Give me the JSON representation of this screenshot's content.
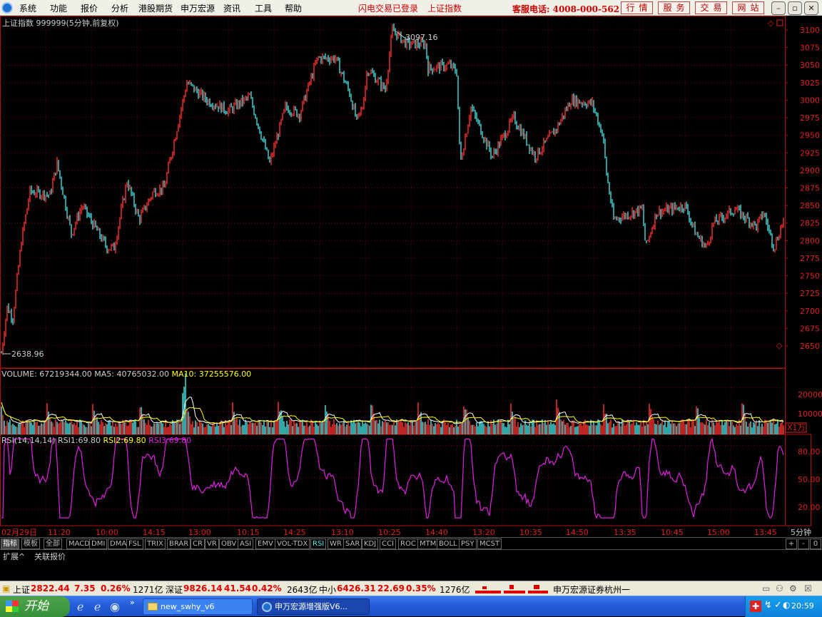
{
  "menu": {
    "items": [
      "系统",
      "功能",
      "报价",
      "分析",
      "港股期货",
      "申万宏源",
      "资讯",
      "工具",
      "帮助"
    ],
    "login_status": "闪电交易已登录",
    "current_index": "上证指数",
    "service_phone": "客服电话: 4008-000-562",
    "buttons": [
      "行情",
      "服务",
      "交易",
      "网站"
    ]
  },
  "chart": {
    "title": "上证指数 999999(5分钟,前复权)",
    "high_label": "3097.16",
    "low_label": "2638.96",
    "price_axis": [
      "3100",
      "3075",
      "3050",
      "3025",
      "3000",
      "2975",
      "2950",
      "2925",
      "2900",
      "2875",
      "2850",
      "2825",
      "2800",
      "2775",
      "2750",
      "2725",
      "2700",
      "2675",
      "2650"
    ],
    "volume": {
      "label_name": "VOLUME:",
      "value": "67219344.00",
      "ma5_name": "MA5:",
      "ma5_value": "40765032.00",
      "ma10_name": "MA10:",
      "ma10_value": "37255576.00",
      "axis": [
        "20000",
        "10000"
      ],
      "unit": "X1万"
    },
    "rsi": {
      "label_name": "RSI(14,14,14)",
      "rsi1_name": "RSI1:",
      "rsi1": "69.80",
      "rsi2_name": "RSI2:",
      "rsi2": "69.80",
      "rsi3_name": "RSI3:",
      "rsi3": "69.80",
      "axis": [
        "80.00",
        "50.00",
        "20.00"
      ]
    },
    "time_axis": [
      "02月29日",
      "11:20",
      "10:00",
      "14:15",
      "13:00",
      "10:15",
      "14:25",
      "13:10",
      "10:25",
      "14:40",
      "13:20",
      "10:35",
      "14:50",
      "13:35",
      "10:45",
      "15:00",
      "13:45"
    ],
    "period": "5分钟",
    "colors": {
      "grid": "#7a0000",
      "up": "#ff3030",
      "down": "#40e0e0",
      "ma5": "#ffffff",
      "ma10": "#ffff00",
      "rsi": "#e020e0",
      "frame": "#b01010"
    }
  },
  "indicators": [
    "指标",
    "模板",
    "全部",
    "MACD",
    "DMI",
    "DMA",
    "FSL",
    "TRIX",
    "BRAR",
    "CR",
    "VR",
    "OBV",
    "ASI",
    "EMV",
    "VOL-TDX",
    "RSI",
    "WR",
    "SAR",
    "KDJ",
    "CCI",
    "ROC",
    "MTM",
    "BOLL",
    "PSY",
    "MCST"
  ],
  "indicator_selected": "RSI",
  "nav_buttons": [
    "+",
    "-",
    "0"
  ],
  "ext_tabs": [
    "扩展^",
    "关联报价"
  ],
  "status": {
    "sh_name": "上证",
    "sh_price": "2822.44",
    "sh_change": "7.35",
    "sh_pct": "0.26%",
    "sh_amount": "1271亿",
    "sz_name": "深证",
    "sz_price": "9826.14",
    "sz_change": "41.54",
    "sz_pct": "0.42%",
    "sz_amount": "2643亿",
    "zx_name": "中小",
    "zx_price": "6426.31",
    "zx_change": "22.69",
    "zx_pct": "0.35%",
    "zx_amount": "1276亿",
    "broker": "申万宏源证券杭州一"
  },
  "taskbar": {
    "start": "开始",
    "tasks": [
      "new_swhy_v6",
      "申万宏源增强版V6..."
    ],
    "clock": "20:59"
  }
}
